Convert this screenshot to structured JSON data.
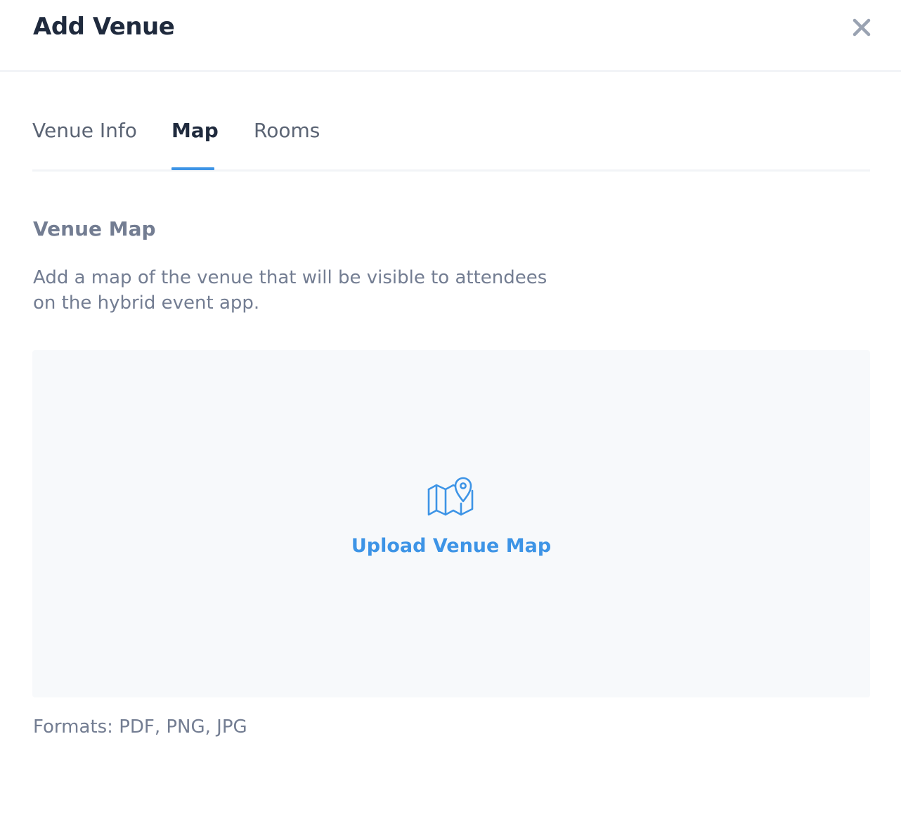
{
  "modal": {
    "title": "Add Venue",
    "close_icon": "close-icon"
  },
  "tabs": [
    {
      "label": "Venue Info",
      "active": false
    },
    {
      "label": "Map",
      "active": true
    },
    {
      "label": "Rooms",
      "active": false
    }
  ],
  "venue_map": {
    "title": "Venue Map",
    "description": "Add a map of the venue that will be visible to attendees on the hybrid event app.",
    "upload_icon": "map-pin-icon",
    "upload_label": "Upload Venue Map",
    "formats": "Formats: PDF, PNG, JPG"
  },
  "colors": {
    "accent": "#3d94e6",
    "title_text": "#1f2a3d",
    "muted_text": "#737d92",
    "dropzone_bg": "#f7f9fb"
  }
}
